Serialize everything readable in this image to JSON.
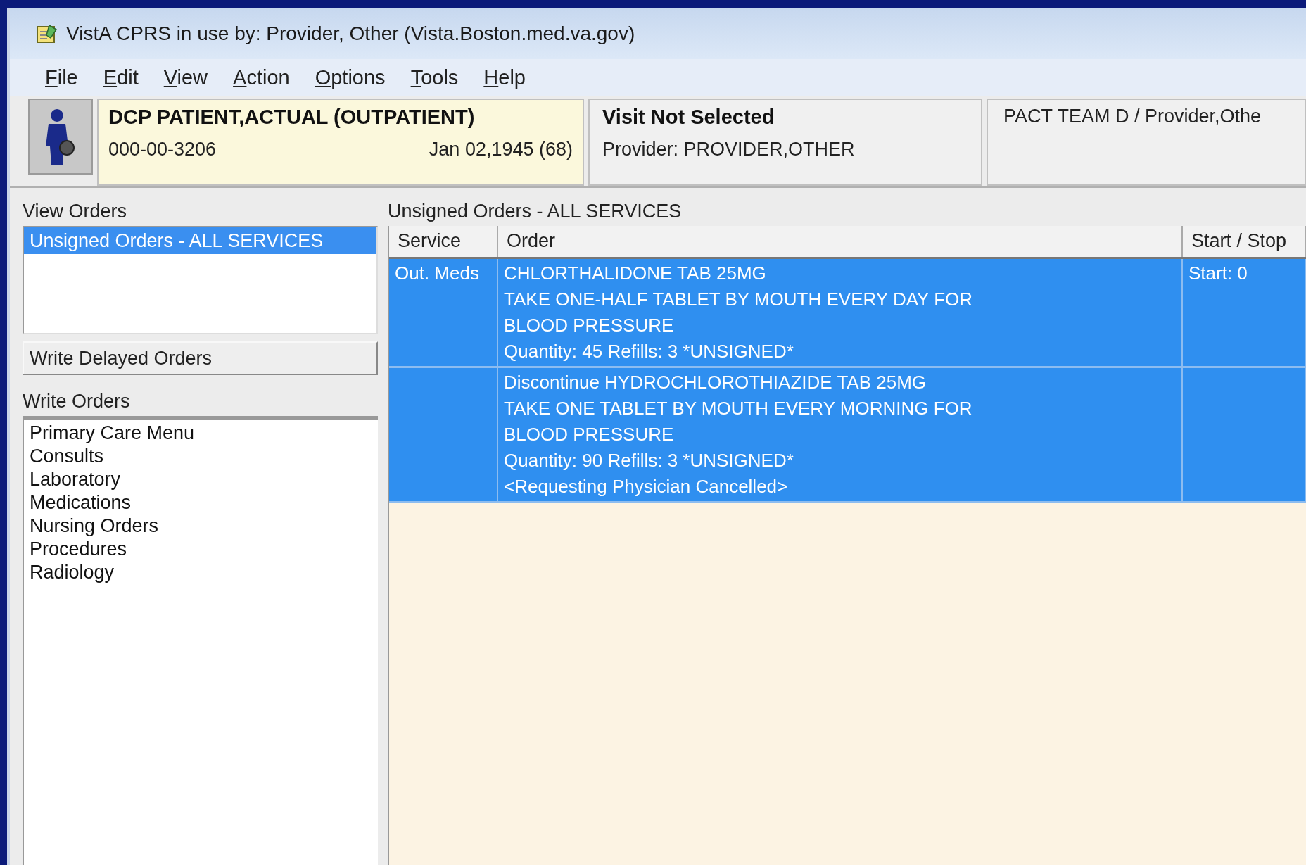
{
  "window": {
    "title": "VistA CPRS in use by: Provider, Other (Vista.Boston.med.va.gov)"
  },
  "menu": [
    "File",
    "Edit",
    "View",
    "Action",
    "Options",
    "Tools",
    "Help"
  ],
  "patient": {
    "name": "DCP PATIENT,ACTUAL (OUTPATIENT)",
    "ssn": "000-00-3206",
    "dob": "Jan 02,1945 (68)"
  },
  "visit": {
    "title": "Visit Not Selected",
    "provider": "Provider: PROVIDER,OTHER"
  },
  "team": {
    "text": "PACT TEAM D / Provider,Othe"
  },
  "view_orders": {
    "label": "View Orders",
    "items": [
      {
        "label": "Unsigned Orders - ALL SERVICES",
        "selected": true
      }
    ]
  },
  "delayed_button": "Write Delayed Orders",
  "write_orders": {
    "label": "Write Orders",
    "items": [
      {
        "label": "Primary Care Menu",
        "selected": false
      },
      {
        "label": "Consults",
        "selected": false
      },
      {
        "label": "Laboratory",
        "selected": false
      },
      {
        "label": "Medications",
        "selected": false
      },
      {
        "label": "Nursing Orders",
        "selected": false
      },
      {
        "label": "Procedures",
        "selected": false
      },
      {
        "label": "Radiology",
        "selected": false
      }
    ]
  },
  "orders": {
    "title": "Unsigned Orders - ALL SERVICES",
    "columns": [
      "Service",
      "Order",
      "Start / Stop"
    ],
    "rows": [
      {
        "service": "Out. Meds",
        "lines": [
          "CHLORTHALIDONE TAB  25MG",
          "TAKE ONE-HALF TABLET BY MOUTH EVERY DAY FOR",
          "BLOOD PRESSURE",
          "Quantity: 45 Refills: 3 *UNSIGNED*"
        ],
        "start": "Start: 0",
        "selected": true
      },
      {
        "lines": [
          "Discontinue HYDROCHLOROTHIAZIDE TAB  25MG",
          "TAKE ONE TABLET BY MOUTH EVERY MORNING FOR",
          "BLOOD PRESSURE",
          "Quantity: 90 Refills: 3 *UNSIGNED*",
          "<Requesting Physician Cancelled>"
        ],
        "selected": true
      }
    ]
  }
}
